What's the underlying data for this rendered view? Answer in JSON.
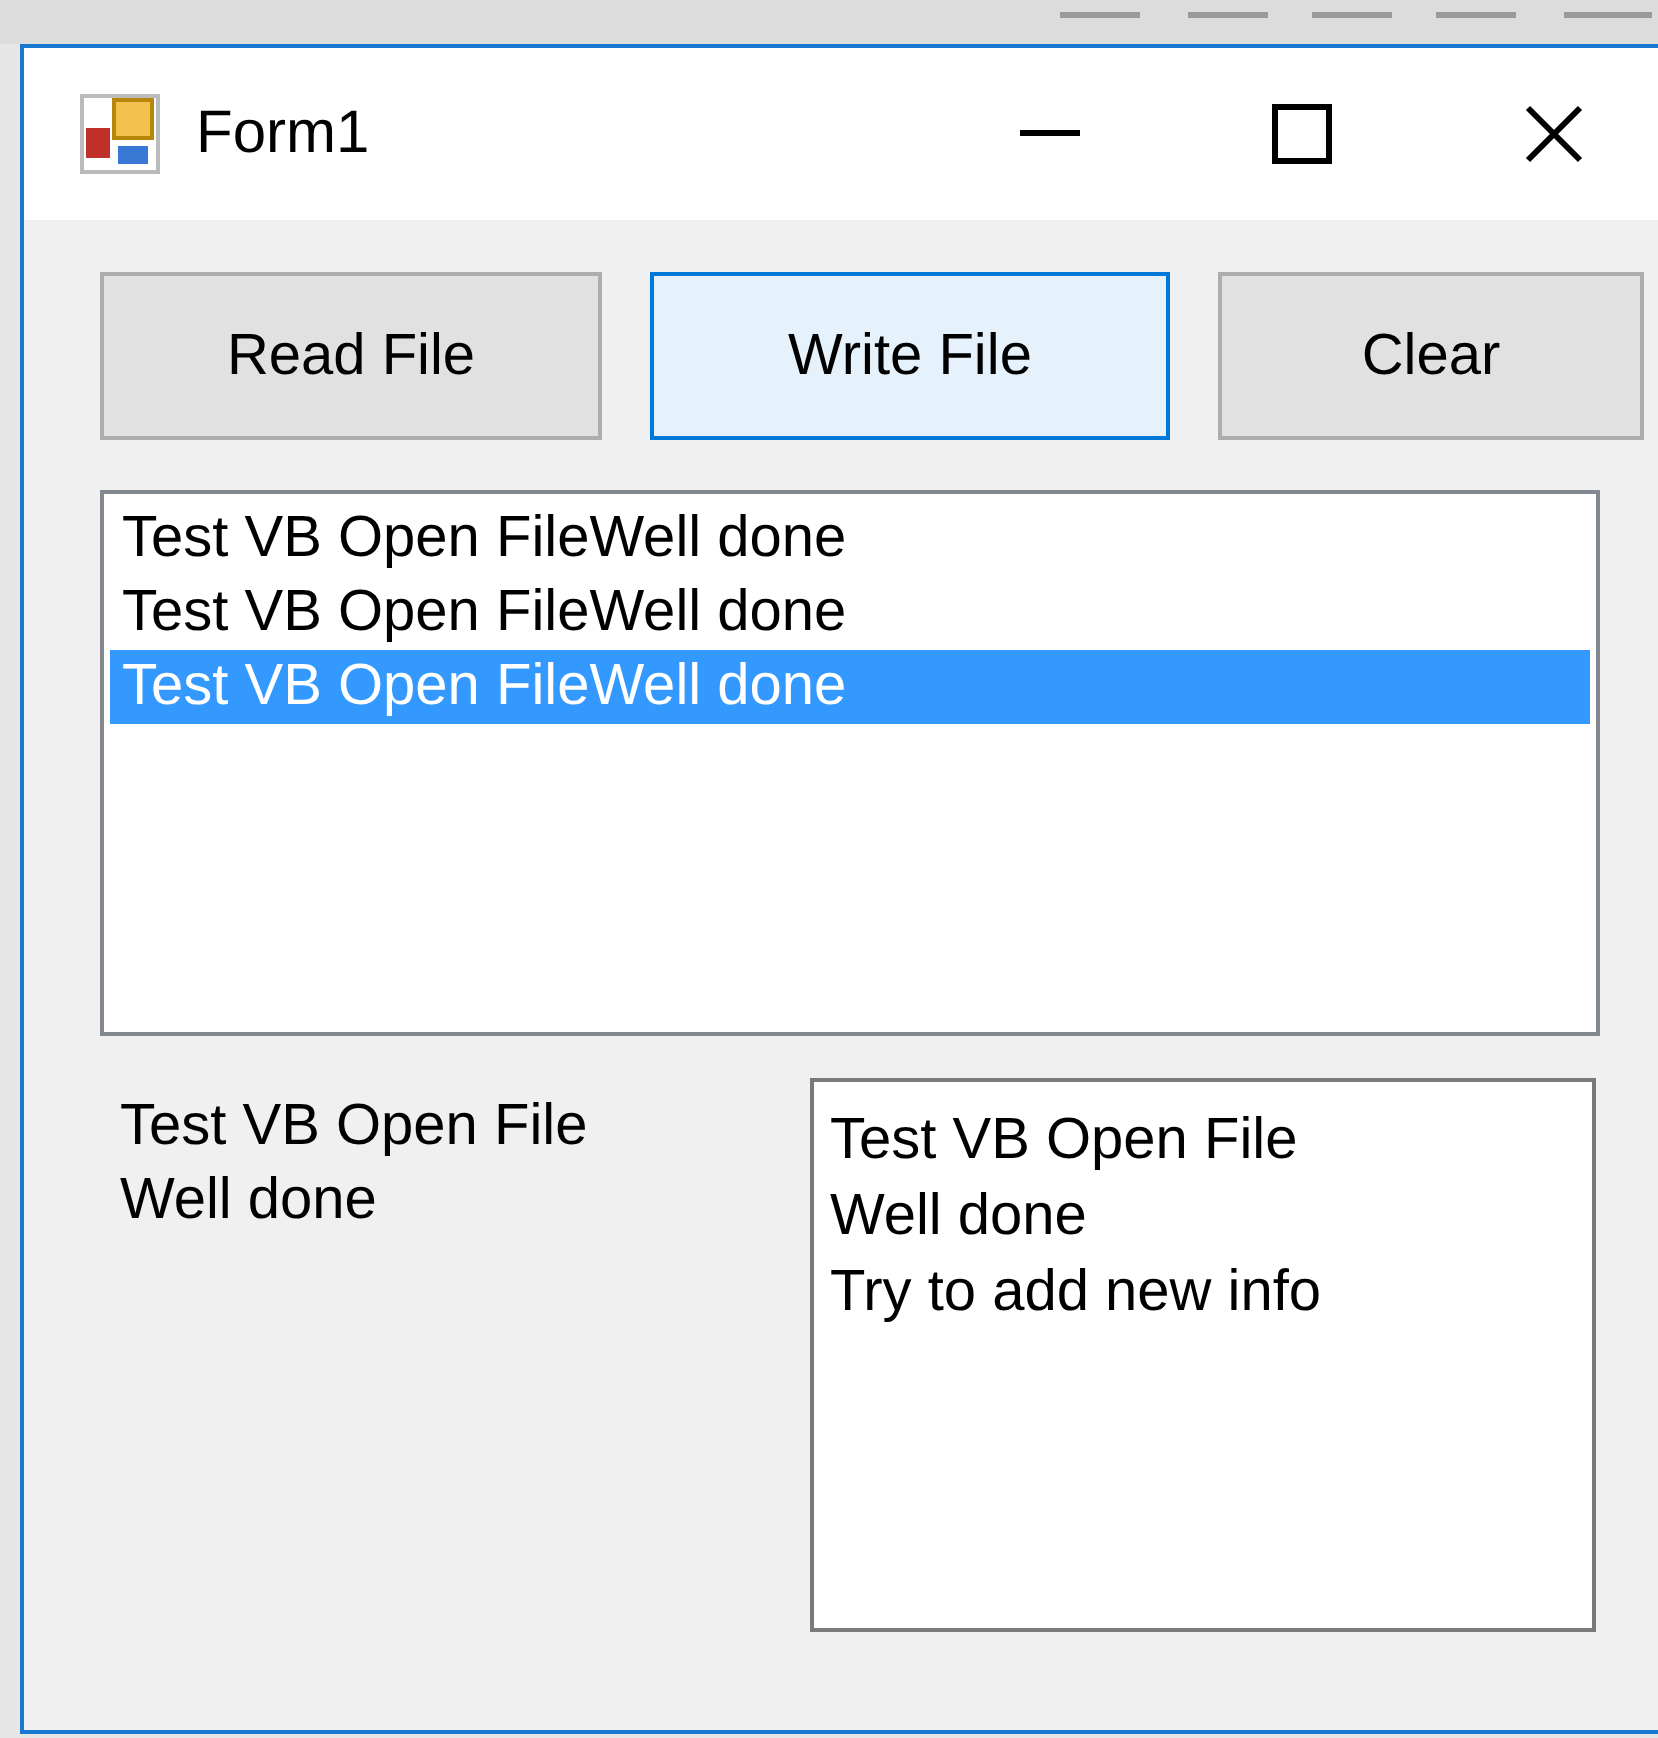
{
  "window": {
    "title": "Form1"
  },
  "buttons": [
    {
      "label": "Read File",
      "focused": false
    },
    {
      "label": "Write File",
      "focused": true
    },
    {
      "label": "Clear",
      "focused": false
    }
  ],
  "listbox": {
    "items": [
      {
        "text": "Test VB Open FileWell done",
        "selected": false
      },
      {
        "text": "Test VB Open FileWell done",
        "selected": false
      },
      {
        "text": "Test VB Open FileWell done",
        "selected": true
      }
    ]
  },
  "label": {
    "lines": [
      "Test VB Open File",
      "Well done"
    ]
  },
  "textbox": {
    "lines": [
      "Test VB Open File",
      "Well done",
      "Try to add new info"
    ]
  }
}
